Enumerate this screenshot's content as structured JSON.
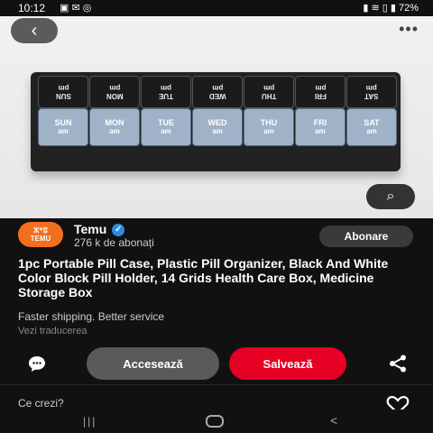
{
  "status_bar": {
    "time": "10:12",
    "left_icons": "▣ ✉ ◎",
    "battery": "72%",
    "signal": "▮ ≋ ▯ ▮"
  },
  "photo": {
    "back_icon": "‹",
    "more_icon": "•••",
    "lens_icon": "⌕",
    "lids": [
      "SUN\npm",
      "MON\npm",
      "TUE\npm",
      "WED\npm",
      "THU\npm",
      "FRI\npm",
      "SAT\npm"
    ],
    "cells": [
      {
        "day": "SUN",
        "time": "am"
      },
      {
        "day": "MON",
        "time": "am"
      },
      {
        "day": "TUE",
        "time": "am"
      },
      {
        "day": "WED",
        "time": "am"
      },
      {
        "day": "THU",
        "time": "am"
      },
      {
        "day": "FRI",
        "time": "am"
      },
      {
        "day": "SAT",
        "time": "am"
      }
    ]
  },
  "channel": {
    "logo_line1": "ⵣ꙳ⵓ",
    "logo_line2": "TEMU",
    "name": "Temu",
    "verified_icon": "✓",
    "subscribers": "276 k de abonați",
    "subscribe_label": "Abonare"
  },
  "pin": {
    "title": "1pc Portable Pill Case, Plastic Pill Organizer, Black And White Color Block Pill Holder, 14 Grids Health Care Box, Medicine Storage Box",
    "description": "Faster shipping. Better service",
    "translate_label": "Vezi traducerea"
  },
  "actions": {
    "access_label": "Accesează",
    "save_label": "Salvează",
    "save_color": "#e60023"
  },
  "comments": {
    "prompt": "Ce crezi?"
  },
  "nav_bar": {
    "recent_icon": "|||",
    "back_icon": "<"
  }
}
